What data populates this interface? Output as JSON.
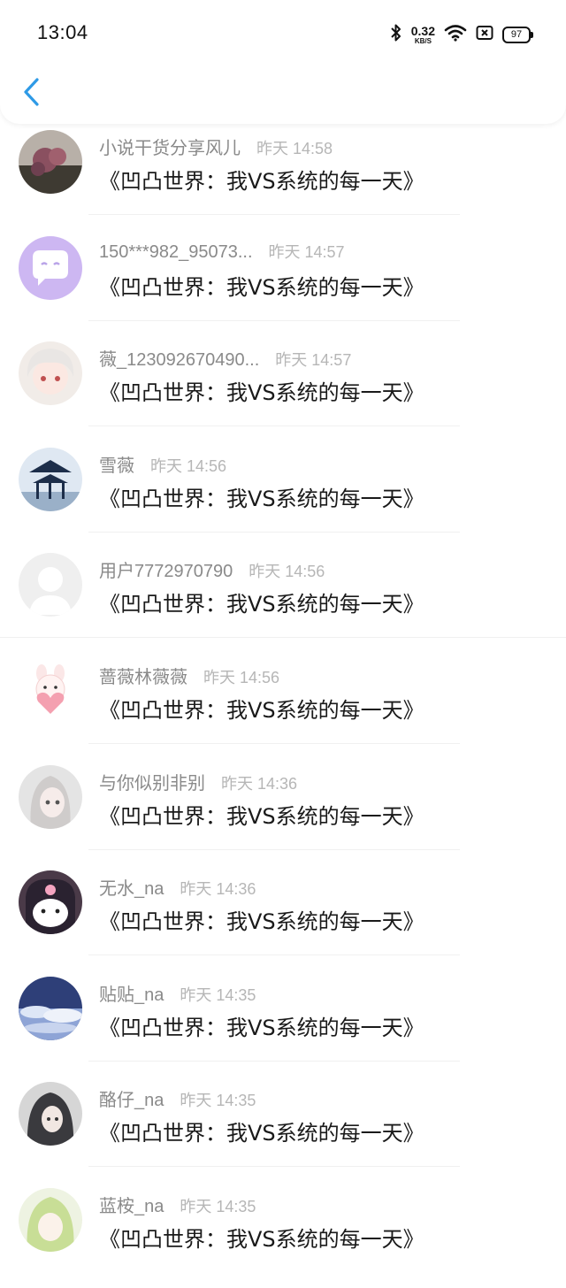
{
  "status_bar": {
    "time": "13:04",
    "net_speed": "0.32",
    "net_unit": "KB/S",
    "battery": "97"
  },
  "header": {
    "back_icon": "chevron-left-icon"
  },
  "items": [
    {
      "name": "小说干货分享风儿",
      "time": "昨天 14:58",
      "message": "《凹凸世界：我VS系统的每一天》",
      "avatar": "flower-photo"
    },
    {
      "name": "150***982_95073...",
      "time": "昨天 14:57",
      "message": "《凹凸世界：我VS系统的每一天》",
      "avatar": "chat-bubble-face"
    },
    {
      "name": "薇_123092670490...",
      "time": "昨天 14:57",
      "message": "《凹凸世界：我VS系统的每一天》",
      "avatar": "anime-white-hair"
    },
    {
      "name": "雪薇",
      "time": "昨天 14:56",
      "message": "《凹凸世界：我VS系统的每一天》",
      "avatar": "pavilion"
    },
    {
      "name": "用户7772970790",
      "time": "昨天 14:56",
      "message": "《凹凸世界：我VS系统的每一天》",
      "avatar": "default-user"
    },
    {
      "name": "蔷薇林薇薇",
      "time": "昨天 14:56",
      "message": "《凹凸世界：我VS系统的每一天》",
      "avatar": "bunny-heart"
    },
    {
      "name": "与你似别非别",
      "time": "昨天 14:36",
      "message": "《凹凸世界：我VS系统的每一天》",
      "avatar": "anime-girl-gray"
    },
    {
      "name": "无水_na",
      "time": "昨天 14:36",
      "message": "《凹凸世界：我VS系统的每一天》",
      "avatar": "kuromi"
    },
    {
      "name": "贴贴_na",
      "time": "昨天 14:35",
      "message": "《凹凸世界：我VS系统的每一天》",
      "avatar": "cloud-sky"
    },
    {
      "name": "酪仔_na",
      "time": "昨天 14:35",
      "message": "《凹凸世界：我VS系统的每一天》",
      "avatar": "anime-dark-hair"
    },
    {
      "name": "蓝桉_na",
      "time": "昨天 14:35",
      "message": "《凹凸世界：我VS系统的每一天》",
      "avatar": "anime-green-hair"
    }
  ]
}
